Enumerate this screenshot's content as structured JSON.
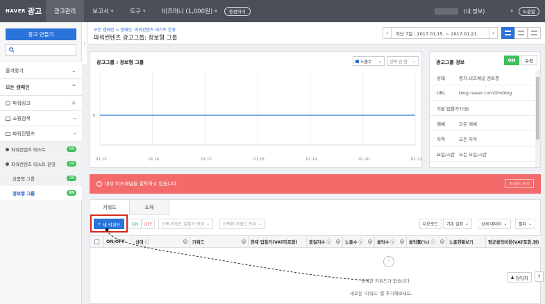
{
  "topbar": {
    "logo_naver": "NAVER",
    "logo_ad": "광고",
    "nav": [
      {
        "label": "광고관리",
        "active": true,
        "chevron": false
      },
      {
        "label": "보고서",
        "active": false,
        "chevron": true
      },
      {
        "label": "도구",
        "active": false,
        "chevron": true
      },
      {
        "label": "비즈머니 (1,000원)",
        "active": false,
        "chevron": true
      }
    ],
    "cash_button": "충전하기",
    "my_info": "(내 정보)",
    "help": "도움말"
  },
  "sidebar": {
    "create_button": "광고 만들기",
    "favorites": "즐겨찾기",
    "all_campaigns": "모든 캠페인",
    "campaigns": [
      {
        "label": "파워링크",
        "action": "+"
      },
      {
        "label": "쇼핑검색",
        "action": "–"
      },
      {
        "label": "파워컨텐츠",
        "action": "–"
      }
    ],
    "subs": [
      {
        "label": "파워컨텐츠 테스트",
        "badge": "ON"
      },
      {
        "label": "파워컨텐츠 테스트 운영",
        "badge": "ON"
      },
      {
        "label": "상품형 그룹",
        "badge": "ON"
      },
      {
        "label": "정보형 그룹",
        "badge": "ON"
      }
    ]
  },
  "header": {
    "breadcrumb": "모든 캠페인 > 캠페인: 파워컨텐츠 테스트 운영",
    "title": "파워컨텐츠 광고그룹: 정보형 그룹",
    "date_range": "지난 7일 : 2017.01.15. ~ 2017.01.21."
  },
  "chart_panel": {
    "title": "광고그룹 : 정보형 그룹",
    "metric_select": "노출수",
    "metric_select2": "선택 안 함"
  },
  "chart_data": {
    "type": "line",
    "title": "",
    "x": [
      "01.15.",
      "01.16.",
      "01.17.",
      "01.18.",
      "01.19.",
      "01.20.",
      "01.21."
    ],
    "series": [
      {
        "name": "노출수",
        "values": [
          0,
          0,
          0,
          0,
          0,
          0,
          0
        ]
      }
    ],
    "y_tick": "0",
    "color": "#2a73d9"
  },
  "info_panel": {
    "title": "광고그룹 정보",
    "toggle": "ON",
    "edit": "수정",
    "rows": [
      {
        "k": "상태",
        "v": "중지:비즈채널 검토중"
      },
      {
        "k": "URL",
        "v": "blog.naver.com/limblog"
      },
      {
        "k": "기본 입찰가",
        "v": "70원"
      },
      {
        "k": "매체",
        "v": "모든 매체"
      },
      {
        "k": "지역",
        "v": "모든 지역"
      },
      {
        "k": "요일/시간",
        "v": "모든 요일/시간"
      }
    ]
  },
  "alert": {
    "text": "대상 비즈채널을 검토하고 있습니다.",
    "button": "자세히 보기"
  },
  "tabs": [
    "키워드",
    "소재"
  ],
  "toolbar": {
    "new_keyword": "새 키워드",
    "on": "ON",
    "off": "OFF",
    "bid_change": "선택 키워드 입찰가 변경",
    "manage": "선택한 키워드 관리",
    "download": "다운로드",
    "default_settings": "기본 설정",
    "detail_data": "상세 데이터",
    "filter": "필터"
  },
  "table": {
    "columns": [
      "ON/OFF",
      "상태",
      "키워드",
      "현재 입찰가(VAT미포함)",
      "품질지수",
      "노출수",
      "클릭수",
      "클릭률(%)",
      "노출현황보기",
      "평균클릭비용(VAT포함,원)"
    ],
    "empty_line1": "등록한 키워드가 없습니다.",
    "empty_line2": "새로운 '키워드' 를 추가해보세요."
  },
  "buttons": {
    "manager": "담당자"
  }
}
